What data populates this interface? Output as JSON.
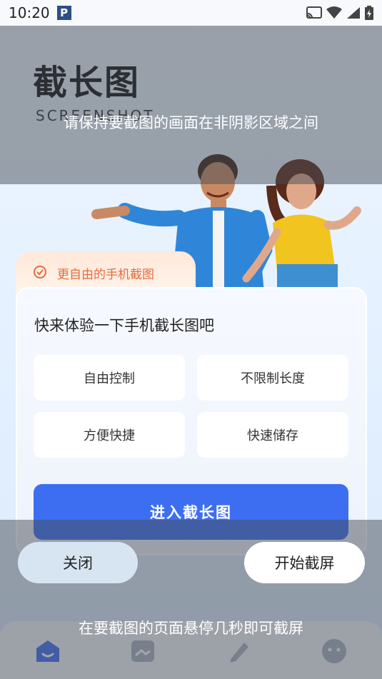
{
  "status_bar": {
    "time": "10:20",
    "app_badge": "P"
  },
  "hero": {
    "title": "截长图",
    "subtitle": "SCREENSHOT"
  },
  "card": {
    "tab_label": "更自由的手机截图",
    "title": "快来体验一下手机截长图吧",
    "features": [
      "自由控制",
      "不限制长度",
      "方便快捷",
      "快速储存"
    ],
    "enter_button": "进入截长图"
  },
  "overlay": {
    "top_hint": "请保持要截图的画面在非阴影区域之间",
    "bottom_hint": "在要截图的页面悬停几秒即可截屏",
    "close_button": "关闭",
    "start_button": "开始截屏"
  },
  "colors": {
    "accent": "#3d6ef2",
    "tab_text": "#e96a3a"
  },
  "icons": {
    "status": [
      "cast-icon",
      "wifi-icon",
      "signal-icon",
      "battery-icon"
    ],
    "nav": [
      "home-icon",
      "gallery-icon",
      "edit-icon",
      "profile-icon"
    ]
  }
}
